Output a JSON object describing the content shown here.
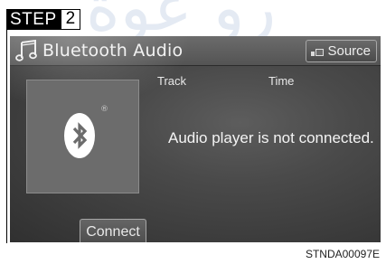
{
  "step": {
    "word": "STEP",
    "number": "2"
  },
  "screen": {
    "title": "Bluetooth Audio",
    "source_label": "Source",
    "columns": {
      "track": "Track",
      "time": "Time"
    },
    "status_message": "Audio player is not connected.",
    "connect_label": "Connect",
    "album_art_mark": "®"
  },
  "figure_code": "STNDA00097E",
  "icons": [
    "music-note-icon",
    "source-icon",
    "bluetooth-icon"
  ],
  "colors": {
    "screen_bg": "#474747",
    "text": "#f2f2f2",
    "step_bg": "#000000"
  }
}
